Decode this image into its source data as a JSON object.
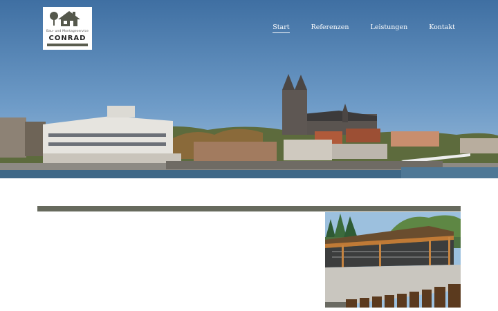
{
  "logo": {
    "subtitle": "Bau- und Montageservice",
    "name": "CONRAD",
    "icon": "house-tree-logo"
  },
  "nav": {
    "items": [
      {
        "label": "Start",
        "active": true
      },
      {
        "label": "Referenzen",
        "active": false
      },
      {
        "label": "Leistungen",
        "active": false
      },
      {
        "label": "Kontakt",
        "active": false
      }
    ]
  },
  "hero": {
    "image": "city-skyline-cathedral-photo"
  },
  "content": {
    "image": "wooden-pavilion-photo"
  },
  "colors": {
    "accent": "#676a5d",
    "sky": "#4f7fb0",
    "nav_text": "#ffffff"
  }
}
